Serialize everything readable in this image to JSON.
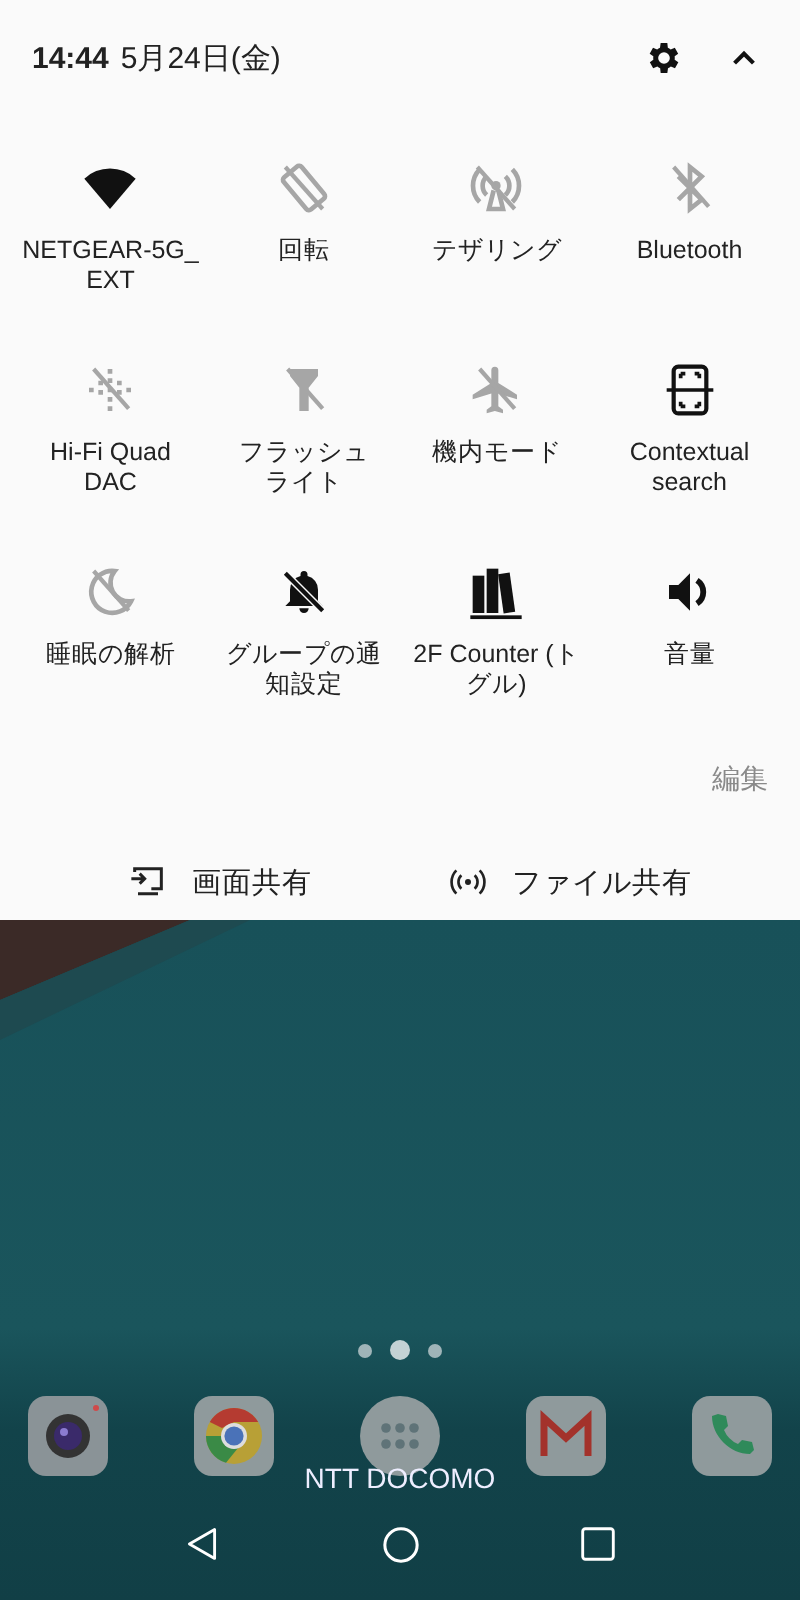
{
  "header": {
    "time": "14:44",
    "date": "5月24日(金)"
  },
  "tiles": [
    {
      "lines": [
        "NETGEAR-5G_",
        "EXT"
      ],
      "kind": "wifi",
      "on": true
    },
    {
      "lines": [
        "回転"
      ],
      "kind": "rotate",
      "on": false
    },
    {
      "lines": [
        "テザリング"
      ],
      "kind": "hotspot",
      "on": false
    },
    {
      "lines": [
        "Bluetooth"
      ],
      "kind": "bluetooth",
      "on": false
    },
    {
      "lines": [
        "Hi-Fi Quad",
        "DAC"
      ],
      "kind": "dac",
      "on": false
    },
    {
      "lines": [
        "フラッシュ",
        "ライト"
      ],
      "kind": "flashlight",
      "on": false
    },
    {
      "lines": [
        "機内モード"
      ],
      "kind": "airplane",
      "on": false
    },
    {
      "lines": [
        "Contextual",
        "search"
      ],
      "kind": "contextual",
      "on": true
    },
    {
      "lines": [
        "睡眠の解析"
      ],
      "kind": "sleep",
      "on": false
    },
    {
      "lines": [
        "グループの通",
        "知設定"
      ],
      "kind": "bell_off",
      "on": true
    },
    {
      "lines": [
        "2F Counter (ト",
        "グル)"
      ],
      "kind": "books",
      "on": true
    },
    {
      "lines": [
        "音量"
      ],
      "kind": "volume",
      "on": true
    }
  ],
  "edit_link": "編集",
  "share_buttons": [
    {
      "label": "画面共有",
      "kind": "screen"
    },
    {
      "label": "ファイル共有",
      "kind": "file"
    }
  ],
  "home": {
    "pages": [
      {
        "selected": false
      },
      {
        "selected": true
      },
      {
        "selected": false
      }
    ],
    "dock": [
      {
        "kind": "camera"
      },
      {
        "kind": "browser"
      },
      {
        "kind": "apps"
      },
      {
        "kind": "mail"
      },
      {
        "kind": "phone"
      }
    ],
    "carrier": "NTT DOCOMO"
  }
}
